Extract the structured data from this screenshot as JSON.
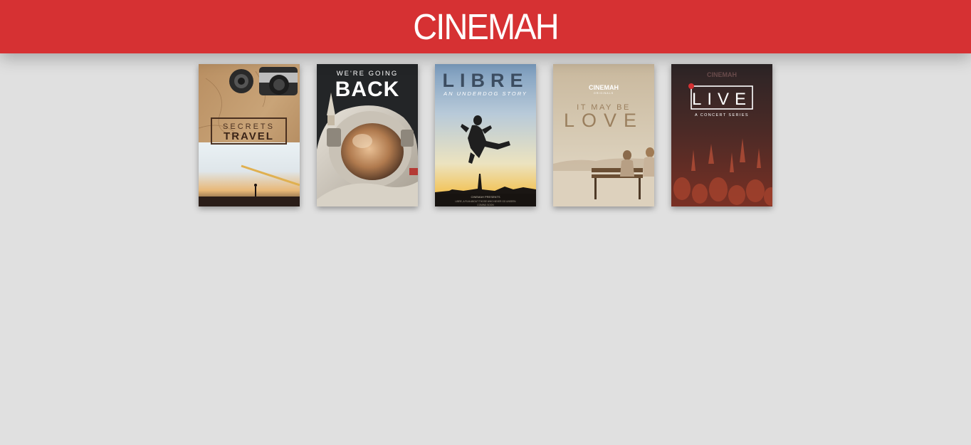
{
  "app": {
    "logo_text": "CINEMAH",
    "brand_color": "#d63133",
    "background_color": "#e0e0e0"
  },
  "posters": [
    {
      "title_line1": "SECRETS",
      "title_line2": "TRAVEL"
    },
    {
      "title_line1": "WE'RE GOING",
      "title_line2": "BACK"
    },
    {
      "title_line1": "LIBRE",
      "title_line2": "AN UNDERDOG STORY",
      "credits_line1": "CINEMAH PRESENTS",
      "credits_line2": "LIBRE, A FILM ABOUT THOSE WHO NEVER GO UNSEEN",
      "credits_line3": "COMING SOON"
    },
    {
      "brand": "CINEMAH",
      "brand_sub": "ORIGINALS",
      "title_line1": "IT MAY BE",
      "title_line2": "LOVE"
    },
    {
      "brand": "CINEMAH",
      "title_line1": "LIVE",
      "title_line2": "A CONCERT SERIES"
    }
  ]
}
